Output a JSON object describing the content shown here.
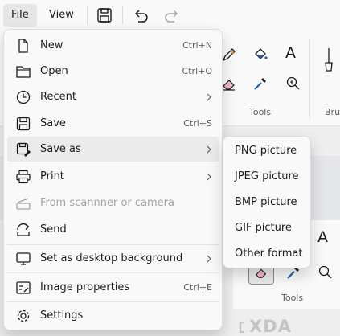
{
  "menubar": {
    "file_label": "File",
    "view_label": "View",
    "icons": [
      "save-icon",
      "undo-icon",
      "redo-icon"
    ]
  },
  "ribbon": {
    "tools_label": "Tools",
    "brushes_label": "Bru",
    "text_glyph": "A",
    "tools_label_2": "Tools"
  },
  "file_menu": {
    "items": [
      {
        "label": "New",
        "shortcut": "Ctrl+N",
        "icon": "new-file-icon"
      },
      {
        "label": "Open",
        "shortcut": "Ctrl+O",
        "icon": "folder-icon"
      },
      {
        "label": "Recent",
        "icon": "clock-icon",
        "submenu": true
      },
      {
        "label": "Save",
        "shortcut": "Ctrl+S",
        "icon": "save-icon"
      },
      {
        "label": "Save as",
        "icon": "save-as-icon",
        "submenu": true,
        "highlighted": true
      },
      {
        "label": "Print",
        "icon": "printer-icon",
        "submenu": true
      },
      {
        "label": "From scannner or camera",
        "icon": "scanner-icon",
        "disabled": true
      },
      {
        "label": "Send",
        "icon": "send-icon"
      },
      {
        "label": "Set as desktop background",
        "icon": "desktop-icon",
        "submenu": true
      },
      {
        "label": "Image properties",
        "shortcut": "Ctrl+E",
        "icon": "image-properties-icon"
      },
      {
        "label": "Settings",
        "icon": "gear-icon"
      }
    ]
  },
  "save_as_submenu": {
    "items": [
      "PNG picture",
      "JPEG picture",
      "BMP picture",
      "GIF picture",
      "Other format"
    ]
  },
  "watermark": "XDA",
  "colors": {
    "menu_bg": "#f9f9f9",
    "highlight": "#ebebeb",
    "disabled_text": "#a3a3a3",
    "shortcut_text": "#5d5d5d"
  }
}
